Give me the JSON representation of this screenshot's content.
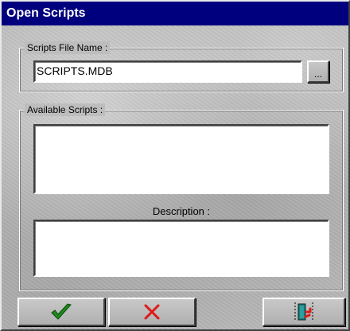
{
  "window": {
    "title": "Open Scripts"
  },
  "scripts_file": {
    "group_label": "Scripts File Name :",
    "value": "SCRIPTS.MDB",
    "browse_label": "..."
  },
  "available": {
    "group_label": "Available Scripts :",
    "items": [],
    "description_label": "Description :",
    "description_text": ""
  },
  "buttons": {
    "ok_icon": "checkmark-icon",
    "cancel_icon": "x-icon",
    "exit_icon": "exit-door-icon"
  },
  "colors": {
    "titlebar": "#00007f",
    "ok": "#1c8a1c",
    "cancel": "#e01818"
  }
}
